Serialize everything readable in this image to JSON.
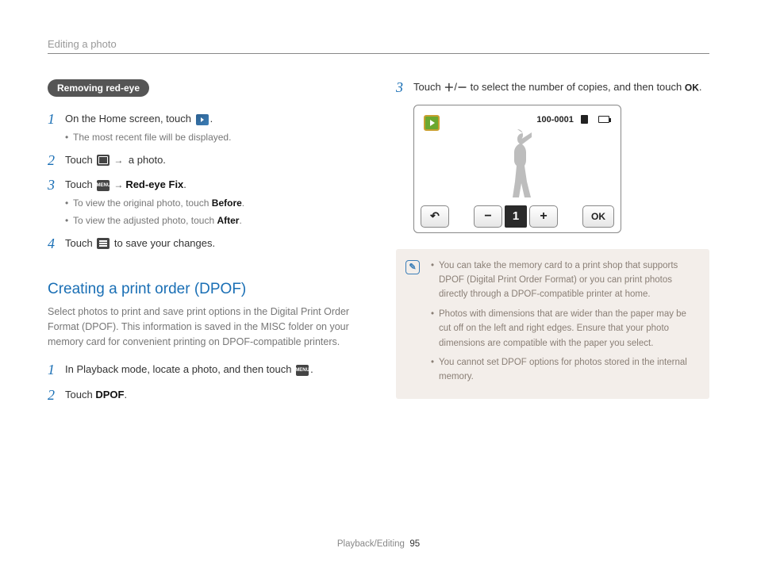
{
  "header": {
    "title": "Editing a photo"
  },
  "left": {
    "pill": "Removing red-eye",
    "steps": [
      {
        "num": "1",
        "body": "On the Home screen, touch ",
        "tail": ".",
        "sub": [
          "The most recent file will be displayed."
        ]
      },
      {
        "num": "2",
        "body_pre": "Touch ",
        "body_post": " a photo."
      },
      {
        "num": "3",
        "body_pre": "Touch ",
        "body_bold": "Red-eye Fix",
        "body_post2": ".",
        "sub": [
          {
            "pre": "To view the original photo, touch ",
            "bold": "Before",
            "post": "."
          },
          {
            "pre": "To view the adjusted photo, touch ",
            "bold": "After",
            "post": "."
          }
        ]
      },
      {
        "num": "4",
        "body_pre": "Touch ",
        "body_post": " to save your changes."
      }
    ],
    "section_title": "Creating a print order (DPOF)",
    "section_desc": "Select photos to print and save print options in the Digital Print Order Format (DPOF). This information is saved in the MISC folder on your memory card for convenient printing on DPOF-compatible printers.",
    "dpof_steps": [
      {
        "num": "1",
        "body_pre": "In Playback mode, locate a photo, and then touch ",
        "body_post": "."
      },
      {
        "num": "2",
        "body_pre": "Touch ",
        "bold": "DPOF",
        "body_post": "."
      }
    ]
  },
  "right": {
    "step3": {
      "num": "3",
      "body_pre": "Touch ",
      "body_mid": " to select the number of copies, and then touch ",
      "body_post": "."
    },
    "cam": {
      "counter": "100-0001",
      "count": "1",
      "ok": "OK"
    },
    "note": [
      "You can take the memory card to a print shop that supports DPOF (Digital Print Order Format) or you can print photos directly through a DPOF-compatible printer at home.",
      "Photos with dimensions that are wider than the paper may be cut off on the left and right edges. Ensure that your photo dimensions are compatible with the paper you select.",
      "You cannot set DPOF options for photos stored in the internal memory."
    ]
  },
  "footer": {
    "section": "Playback/Editing",
    "page": "95"
  }
}
